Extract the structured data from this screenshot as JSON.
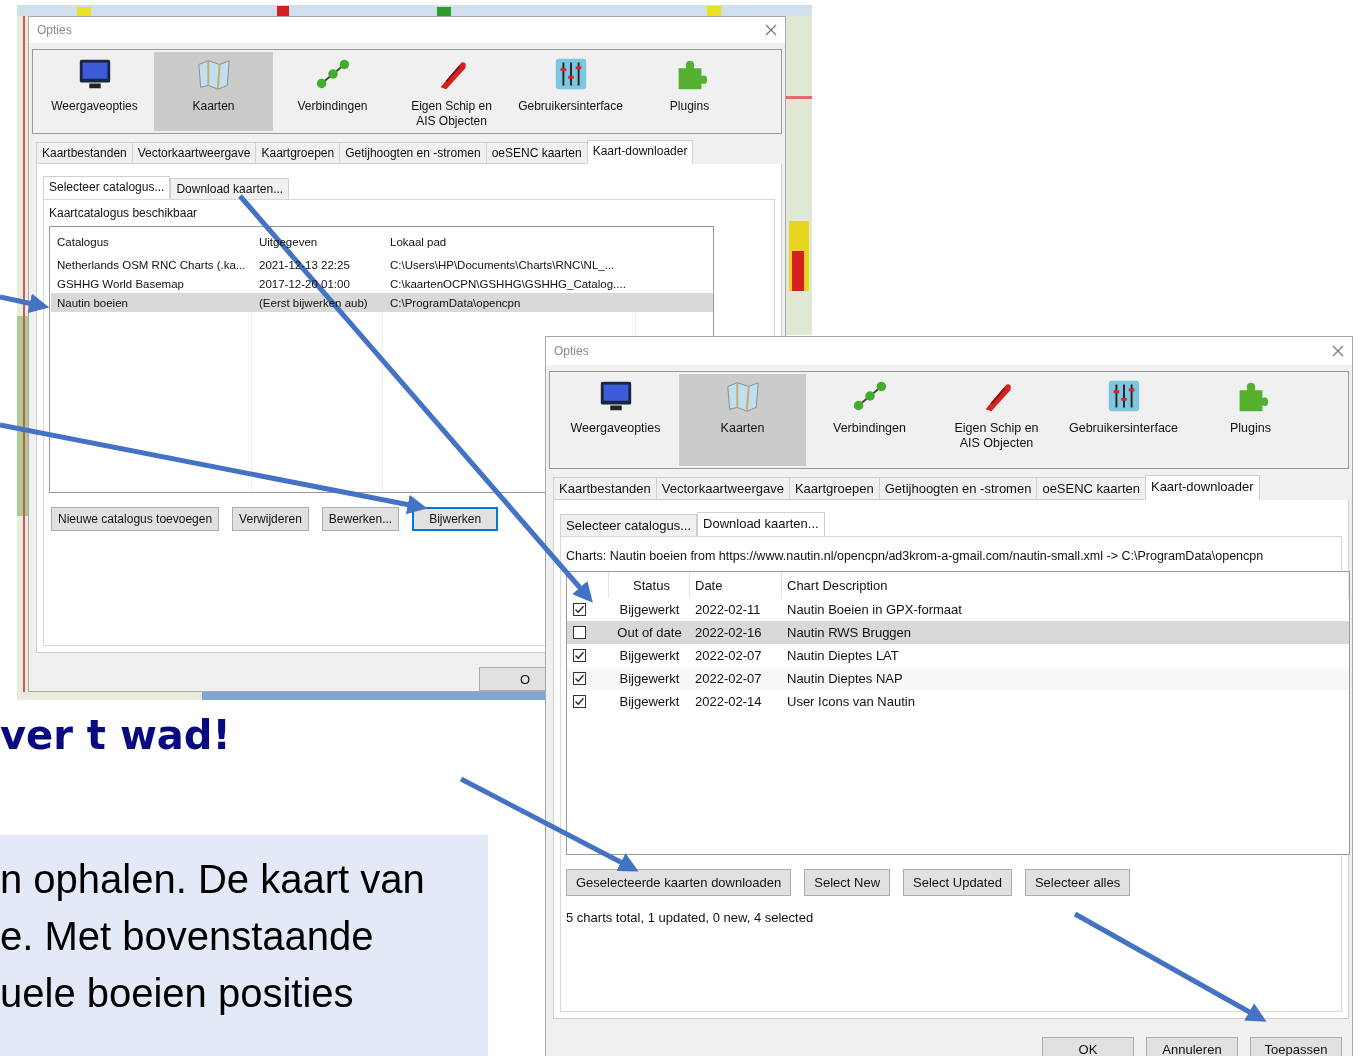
{
  "slide": {
    "heading": "ver t wad!",
    "body_lines": [
      "n ophalen. De kaart van",
      "e. Met bovenstaande",
      "uele boeien posities"
    ]
  },
  "dialogs": [
    {
      "kind": "catalog",
      "title": "Opties",
      "toolbar": [
        {
          "label": "Weergaveopties",
          "selected": false
        },
        {
          "label": "Kaarten",
          "selected": true
        },
        {
          "label": "Verbindingen",
          "selected": false
        },
        {
          "label": "Eigen Schip en AIS Objecten",
          "selected": false
        },
        {
          "label": "Gebruikersinterface",
          "selected": false
        },
        {
          "label": "Plugins",
          "selected": false
        }
      ],
      "tabs": [
        {
          "label": "Kaartbestanden",
          "selected": false
        },
        {
          "label": "Vectorkaartweergave",
          "selected": false
        },
        {
          "label": "Kaartgroepen",
          "selected": false
        },
        {
          "label": "Getijhoogten en -stromen",
          "selected": false
        },
        {
          "label": "oeSENC kaarten",
          "selected": false
        },
        {
          "label": "Kaart-downloader",
          "selected": true
        }
      ],
      "subtabs": [
        {
          "label": "Selecteer catalogus...",
          "selected": true
        },
        {
          "label": "Download kaarten...",
          "selected": false
        }
      ],
      "section_label": "Kaartcatalogus beschikbaar",
      "columns": [
        "Catalogus",
        "Uitgegeven",
        "Lokaal pad"
      ],
      "rows": [
        {
          "cells": [
            "Netherlands OSM RNC Charts (.ka...",
            "2021-12-13 22:25",
            "C:\\Users\\HP\\Documents\\Charts\\RNC\\NL_..."
          ],
          "selected": false
        },
        {
          "cells": [
            "GSHHG World Basemap",
            "2017-12-20 01:00",
            "C:\\kaartenOCPN\\GSHHG\\GSHHG_Catalog...."
          ],
          "selected": false
        },
        {
          "cells": [
            "Nautin boeien",
            "(Eerst bijwerken aub)",
            "C:\\ProgramData\\opencpn"
          ],
          "selected": true
        }
      ],
      "buttons": [
        {
          "label": "Nieuwe catalogus toevoegen",
          "focused": false
        },
        {
          "label": "Verwijderen",
          "focused": false
        },
        {
          "label": "Bewerken...",
          "focused": false
        },
        {
          "label": "Bijwerken",
          "focused": true
        }
      ],
      "footer_buttons": [
        "O"
      ]
    },
    {
      "kind": "download",
      "title": "Opties",
      "toolbar": [
        {
          "label": "Weergaveopties",
          "selected": false
        },
        {
          "label": "Kaarten",
          "selected": true
        },
        {
          "label": "Verbindingen",
          "selected": false
        },
        {
          "label": "Eigen Schip en AIS Objecten",
          "selected": false
        },
        {
          "label": "Gebruikersinterface",
          "selected": false
        },
        {
          "label": "Plugins",
          "selected": false
        }
      ],
      "tabs": [
        {
          "label": "Kaartbestanden",
          "selected": false
        },
        {
          "label": "Vectorkaartweergave",
          "selected": false
        },
        {
          "label": "Kaartgroepen",
          "selected": false
        },
        {
          "label": "Getijhoogten en -stromen",
          "selected": false
        },
        {
          "label": "oeSENC kaarten",
          "selected": false
        },
        {
          "label": "Kaart-downloader",
          "selected": true
        }
      ],
      "subtabs": [
        {
          "label": "Selecteer catalogus...",
          "selected": false
        },
        {
          "label": "Download kaarten...",
          "selected": true
        }
      ],
      "source_path": "Charts: Nautin boeien from https://www.nautin.nl/opencpn/ad3krom-a-gmail.com/nautin-small.xml -> C:\\ProgramData\\opencpn",
      "columns": [
        "Status",
        "Date",
        "Chart Description"
      ],
      "rows": [
        {
          "checked": true,
          "status": "Bijgewerkt",
          "date": "2022-02-11",
          "description": "Nautin Boeien in GPX-formaat",
          "selected": false
        },
        {
          "checked": false,
          "status": "Out of date",
          "date": "2022-02-16",
          "description": "Nautin RWS Bruggen",
          "selected": true
        },
        {
          "checked": true,
          "status": "Bijgewerkt",
          "date": "2022-02-07",
          "description": "Nautin Dieptes LAT",
          "selected": false
        },
        {
          "checked": true,
          "status": "Bijgewerkt",
          "date": "2022-02-07",
          "description": "Nautin Dieptes NAP",
          "selected": false
        },
        {
          "checked": true,
          "status": "Bijgewerkt",
          "date": "2022-02-14",
          "description": "User Icons van Nautin",
          "selected": false
        }
      ],
      "buttons": [
        {
          "label": "Geselecteerde kaarten downloaden",
          "focused": false
        },
        {
          "label": "Select New",
          "focused": false
        },
        {
          "label": "Select Updated",
          "focused": false
        },
        {
          "label": "Selecteer alles",
          "focused": false
        }
      ],
      "summary": "5 charts total, 1 updated, 0 new, 4 selected",
      "footer_buttons": [
        "OK",
        "Annuleren",
        "Toepassen"
      ]
    }
  ]
}
